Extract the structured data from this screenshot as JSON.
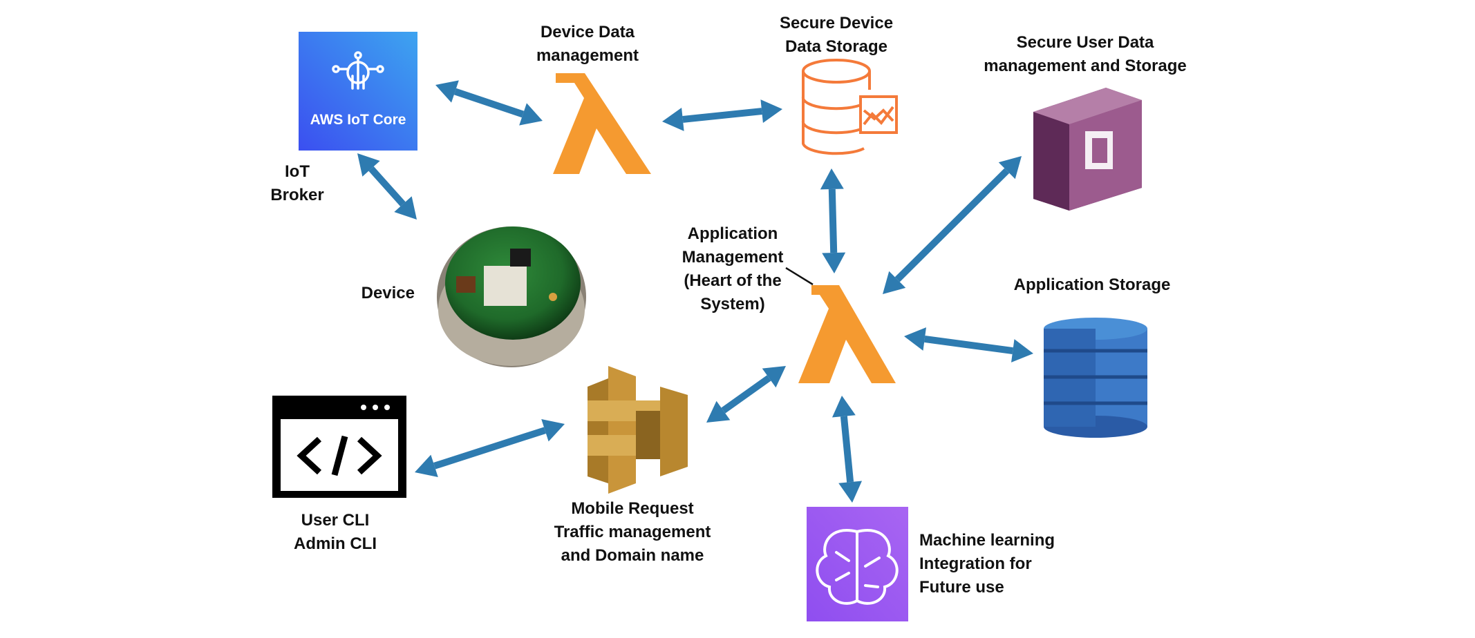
{
  "nodes": {
    "iot_core": {
      "tile_text": "AWS IoT Core",
      "caption": [
        "IoT",
        "Broker"
      ]
    },
    "device_data_lambda": {
      "caption": [
        "Device Data",
        "management"
      ]
    },
    "device_storage": {
      "caption": [
        "Secure Device",
        "Data Storage"
      ]
    },
    "user_data": {
      "caption": [
        "Secure User Data",
        "management and Storage"
      ]
    },
    "device": {
      "caption": [
        "Device"
      ]
    },
    "app_lambda": {
      "caption": [
        "Application",
        "Management",
        "(Heart of the",
        "System)"
      ]
    },
    "app_storage": {
      "caption": [
        "Application Storage"
      ]
    },
    "cli": {
      "caption": [
        "User CLI",
        "Admin CLI"
      ]
    },
    "api_gateway": {
      "caption": [
        "Mobile Request",
        "Traffic management",
        "and Domain name"
      ]
    },
    "ml": {
      "caption": [
        "Machine learning",
        "Integration for",
        "Future use"
      ]
    }
  },
  "edges": [
    [
      "iot_core",
      "device_data_lambda"
    ],
    [
      "device_data_lambda",
      "device_storage"
    ],
    [
      "iot_core",
      "device"
    ],
    [
      "device_storage",
      "app_lambda"
    ],
    [
      "user_data",
      "app_lambda"
    ],
    [
      "app_lambda",
      "app_storage"
    ],
    [
      "api_gateway",
      "app_lambda"
    ],
    [
      "cli",
      "api_gateway"
    ],
    [
      "app_lambda",
      "ml"
    ]
  ],
  "colors": {
    "arrow": "#2e7bb0",
    "lambda": "#f59a30",
    "storage": "#f47a3a",
    "iot_gradient": [
      "#3d5ff0",
      "#3da0f0"
    ],
    "cognito": [
      "#9c5b8e",
      "#6f3466",
      "#b57fa8"
    ],
    "dynamo": [
      "#2a5ba6",
      "#3d7ac8",
      "#4a8fd6"
    ],
    "api_gateway": [
      "#c9953a",
      "#a87a28",
      "#d9ad55"
    ],
    "ml": "#9a55f0",
    "cli": "#000000"
  }
}
